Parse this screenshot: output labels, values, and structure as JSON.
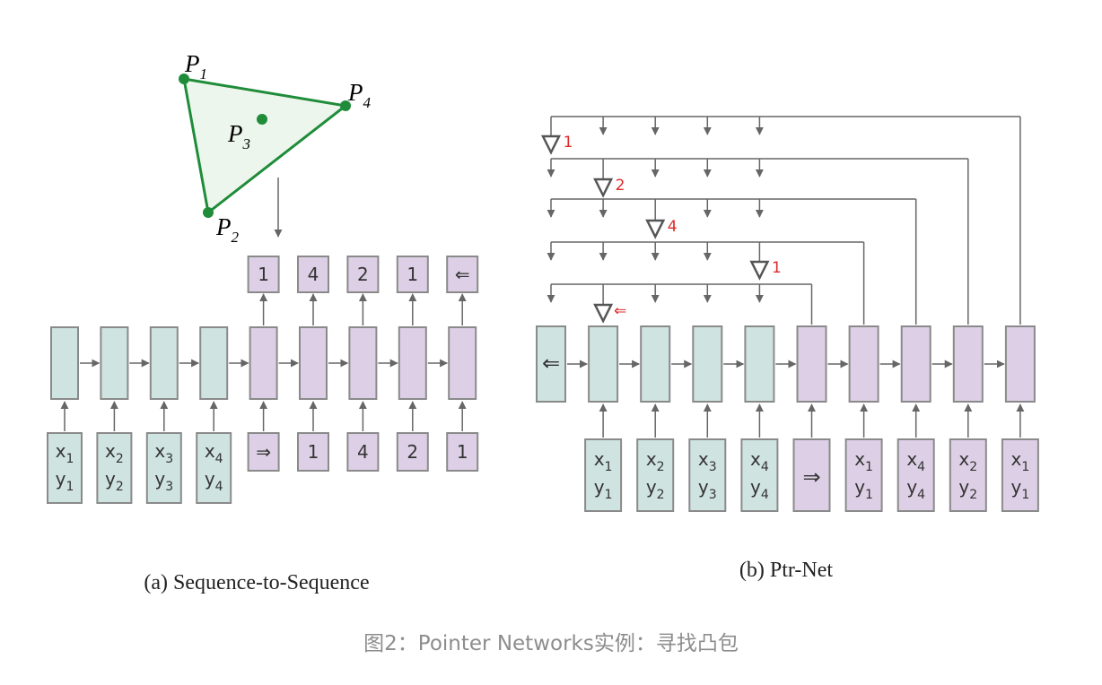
{
  "colors": {
    "encoder_fill": "#cfe3e1",
    "decoder_fill": "#ddd0e6",
    "box_stroke": "#8a8a8a",
    "arrow": "#666666",
    "hull_green": "#1f8c3a",
    "hull_fill": "#edf6ec",
    "pointer_red": "#e02a2a",
    "caption_gray": "#8d8d8d"
  },
  "hull": {
    "points": [
      {
        "label": "P",
        "sub": "1"
      },
      {
        "label": "P",
        "sub": "2"
      },
      {
        "label": "P",
        "sub": "3"
      },
      {
        "label": "P",
        "sub": "4"
      }
    ]
  },
  "seq2seq": {
    "caption": "(a) Sequence-to-Sequence",
    "encoder_inputs": [
      {
        "x": "x",
        "xs": "1",
        "y": "y",
        "ys": "1"
      },
      {
        "x": "x",
        "xs": "2",
        "y": "y",
        "ys": "2"
      },
      {
        "x": "x",
        "xs": "3",
        "y": "y",
        "ys": "3"
      },
      {
        "x": "x",
        "xs": "4",
        "y": "y",
        "ys": "4"
      }
    ],
    "decoder_inputs": [
      "⇒",
      "1",
      "4",
      "2",
      "1"
    ],
    "decoder_outputs": [
      "1",
      "4",
      "2",
      "1",
      "⇐"
    ]
  },
  "ptrnet": {
    "caption": "(b) Ptr-Net",
    "end_token": "⇐",
    "start_token": "⇒",
    "encoder_inputs": [
      {
        "x": "x",
        "xs": "1",
        "y": "y",
        "ys": "1"
      },
      {
        "x": "x",
        "xs": "2",
        "y": "y",
        "ys": "2"
      },
      {
        "x": "x",
        "xs": "3",
        "y": "y",
        "ys": "3"
      },
      {
        "x": "x",
        "xs": "4",
        "y": "y",
        "ys": "4"
      }
    ],
    "decoder_inputs": [
      {
        "x": "x",
        "xs": "1",
        "y": "y",
        "ys": "1"
      },
      {
        "x": "x",
        "xs": "4",
        "y": "y",
        "ys": "4"
      },
      {
        "x": "x",
        "xs": "2",
        "y": "y",
        "ys": "2"
      },
      {
        "x": "x",
        "xs": "1",
        "y": "y",
        "ys": "1"
      }
    ],
    "pointer_labels": [
      "1",
      "2",
      "4",
      "1",
      "⇐"
    ]
  },
  "figure_caption": "图2：Pointer Networks实例：寻找凸包"
}
